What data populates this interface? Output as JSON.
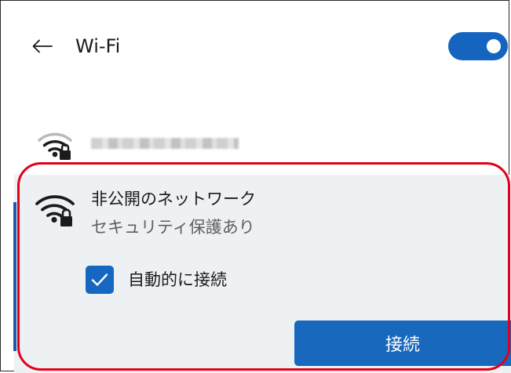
{
  "header": {
    "title": "Wi-Fi",
    "wifi_enabled": true
  },
  "networks": [
    {
      "name_hidden": true,
      "secured": true
    },
    {
      "name": "非公開のネットワーク",
      "subtitle": "セキュリティ保護あり",
      "auto_connect_label": "自動的に接続",
      "auto_connect_checked": true,
      "connect_label": "接続"
    }
  ],
  "colors": {
    "accent": "#1767c0",
    "highlight": "#e0001a",
    "panel_bg": "#eef1f4"
  },
  "icons": [
    "back-arrow-icon",
    "wifi-secured-icon",
    "checkmark-icon"
  ]
}
